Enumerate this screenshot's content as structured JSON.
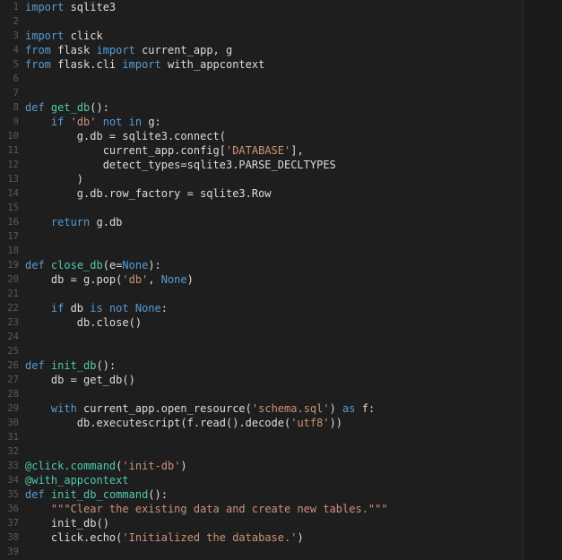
{
  "editor": {
    "language": "python",
    "colors": {
      "background": "#1e1e1e",
      "keyword": "#569cd6",
      "function": "#4ec9b0",
      "string": "#ce9178",
      "text": "#dcdcdc",
      "line_number": "#5a5a5a"
    },
    "lines": [
      {
        "n": "1",
        "t": [
          [
            "kw",
            "import"
          ],
          [
            "d",
            " sqlite3"
          ]
        ]
      },
      {
        "n": "2",
        "t": []
      },
      {
        "n": "3",
        "t": [
          [
            "kw",
            "import"
          ],
          [
            "d",
            " click"
          ]
        ]
      },
      {
        "n": "4",
        "t": [
          [
            "kw",
            "from"
          ],
          [
            "d",
            " flask "
          ],
          [
            "kw",
            "import"
          ],
          [
            "d",
            " current_app, g"
          ]
        ]
      },
      {
        "n": "5",
        "t": [
          [
            "kw",
            "from"
          ],
          [
            "d",
            " flask.cli "
          ],
          [
            "kw",
            "import"
          ],
          [
            "d",
            " with_appcontext"
          ]
        ]
      },
      {
        "n": "6",
        "t": []
      },
      {
        "n": "7",
        "t": []
      },
      {
        "n": "8",
        "t": [
          [
            "kw",
            "def"
          ],
          [
            "d",
            " "
          ],
          [
            "fn",
            "get_db"
          ],
          [
            "d",
            "():"
          ]
        ]
      },
      {
        "n": "9",
        "t": [
          [
            "d",
            "    "
          ],
          [
            "kw",
            "if"
          ],
          [
            "d",
            " "
          ],
          [
            "str",
            "'db'"
          ],
          [
            "d",
            " "
          ],
          [
            "kw",
            "not in"
          ],
          [
            "d",
            " g:"
          ]
        ]
      },
      {
        "n": "10",
        "t": [
          [
            "d",
            "        g.db = sqlite3.connect("
          ]
        ]
      },
      {
        "n": "11",
        "t": [
          [
            "d",
            "            current_app.config["
          ],
          [
            "str",
            "'DATABASE'"
          ],
          [
            "d",
            "],"
          ]
        ]
      },
      {
        "n": "12",
        "t": [
          [
            "d",
            "            detect_types=sqlite3.PARSE_DECLTYPES"
          ]
        ]
      },
      {
        "n": "13",
        "t": [
          [
            "d",
            "        )"
          ]
        ]
      },
      {
        "n": "14",
        "t": [
          [
            "d",
            "        g.db.row_factory = sqlite3.Row"
          ]
        ]
      },
      {
        "n": "15",
        "t": []
      },
      {
        "n": "16",
        "t": [
          [
            "d",
            "    "
          ],
          [
            "kw",
            "return"
          ],
          [
            "d",
            " g.db"
          ]
        ]
      },
      {
        "n": "17",
        "t": []
      },
      {
        "n": "18",
        "t": []
      },
      {
        "n": "19",
        "t": [
          [
            "kw",
            "def"
          ],
          [
            "d",
            " "
          ],
          [
            "fn",
            "close_db"
          ],
          [
            "d",
            "(e="
          ],
          [
            "kw",
            "None"
          ],
          [
            "d",
            "):"
          ]
        ]
      },
      {
        "n": "20",
        "t": [
          [
            "d",
            "    db = g.pop("
          ],
          [
            "str",
            "'db'"
          ],
          [
            "d",
            ", "
          ],
          [
            "kw",
            "None"
          ],
          [
            "d",
            ")"
          ]
        ]
      },
      {
        "n": "21",
        "t": []
      },
      {
        "n": "22",
        "t": [
          [
            "d",
            "    "
          ],
          [
            "kw",
            "if"
          ],
          [
            "d",
            " db "
          ],
          [
            "kw",
            "is not"
          ],
          [
            "d",
            " "
          ],
          [
            "kw",
            "None"
          ],
          [
            "d",
            ":"
          ]
        ]
      },
      {
        "n": "23",
        "t": [
          [
            "d",
            "        db.close()"
          ]
        ]
      },
      {
        "n": "24",
        "t": []
      },
      {
        "n": "25",
        "t": []
      },
      {
        "n": "26",
        "t": [
          [
            "kw",
            "def"
          ],
          [
            "d",
            " "
          ],
          [
            "fn",
            "init_db"
          ],
          [
            "d",
            "():"
          ]
        ]
      },
      {
        "n": "27",
        "t": [
          [
            "d",
            "    db = get_db()"
          ]
        ]
      },
      {
        "n": "28",
        "t": []
      },
      {
        "n": "29",
        "t": [
          [
            "d",
            "    "
          ],
          [
            "kw",
            "with"
          ],
          [
            "d",
            " current_app.open_resource("
          ],
          [
            "str",
            "'schema.sql'"
          ],
          [
            "d",
            ") "
          ],
          [
            "kw",
            "as"
          ],
          [
            "d",
            " f:"
          ]
        ]
      },
      {
        "n": "30",
        "t": [
          [
            "d",
            "        db.executescript(f.read().decode("
          ],
          [
            "str",
            "'utf8'"
          ],
          [
            "d",
            "))"
          ]
        ]
      },
      {
        "n": "31",
        "t": []
      },
      {
        "n": "32",
        "t": []
      },
      {
        "n": "33",
        "t": [
          [
            "fn",
            "@click.command"
          ],
          [
            "d",
            "("
          ],
          [
            "str",
            "'init-db'"
          ],
          [
            "d",
            ")"
          ]
        ]
      },
      {
        "n": "34",
        "t": [
          [
            "fn",
            "@with_appcontext"
          ]
        ]
      },
      {
        "n": "35",
        "t": [
          [
            "kw",
            "def"
          ],
          [
            "d",
            " "
          ],
          [
            "fn",
            "init_db_command"
          ],
          [
            "d",
            "():"
          ]
        ]
      },
      {
        "n": "36",
        "t": [
          [
            "d",
            "    "
          ],
          [
            "str",
            "\"\"\"Clear the existing data and create new tables.\"\"\""
          ]
        ]
      },
      {
        "n": "37",
        "t": [
          [
            "d",
            "    init_db()"
          ]
        ]
      },
      {
        "n": "38",
        "t": [
          [
            "d",
            "    click.echo("
          ],
          [
            "str",
            "'Initialized the database.'"
          ],
          [
            "d",
            ")"
          ]
        ]
      },
      {
        "n": "39",
        "t": []
      }
    ]
  }
}
